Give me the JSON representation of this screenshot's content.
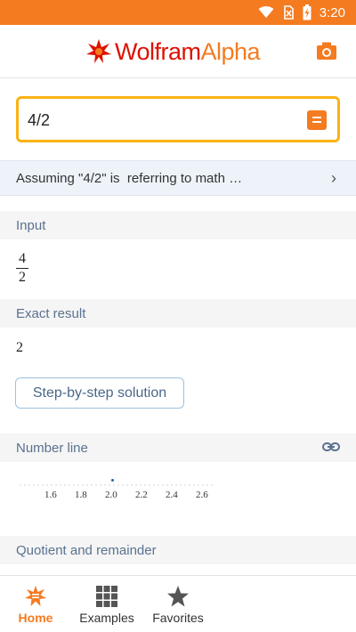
{
  "status_bar": {
    "time": "3:20",
    "background_color": "#f47b20",
    "icons": [
      "wifi-icon",
      "no-sim-icon",
      "battery-charging-icon"
    ]
  },
  "header": {
    "logo_part1": "Wolfram",
    "logo_part2": "Alpha",
    "camera_icon": "camera-icon"
  },
  "search": {
    "value": "4/2",
    "submit_icon": "equals-icon"
  },
  "assumption": {
    "text": "Assuming \"4/2\" is  referring to math …",
    "chevron": "›"
  },
  "pods": {
    "input": {
      "title": "Input",
      "numerator": "4",
      "denominator": "2"
    },
    "exact_result": {
      "title": "Exact result",
      "value": "2",
      "step_button": "Step-by-step solution"
    },
    "number_line": {
      "title": "Number line",
      "link_icon": "link-icon",
      "ticks": [
        "1.6",
        "1.8",
        "2.0",
        "2.2",
        "2.4",
        "2.6"
      ],
      "point": 2.0
    },
    "quotient": {
      "title": "Quotient and remainder"
    }
  },
  "bottom_nav": {
    "items": [
      {
        "label": "Home",
        "icon": "home-icon",
        "active": true
      },
      {
        "label": "Examples",
        "icon": "grid-icon",
        "active": false
      },
      {
        "label": "Favorites",
        "icon": "star-icon",
        "active": false
      }
    ]
  },
  "colors": {
    "accent": "#f47b20",
    "search_border": "#f9b314",
    "assumption_bg": "#edf3f9",
    "pod_title": "#5a7190"
  }
}
